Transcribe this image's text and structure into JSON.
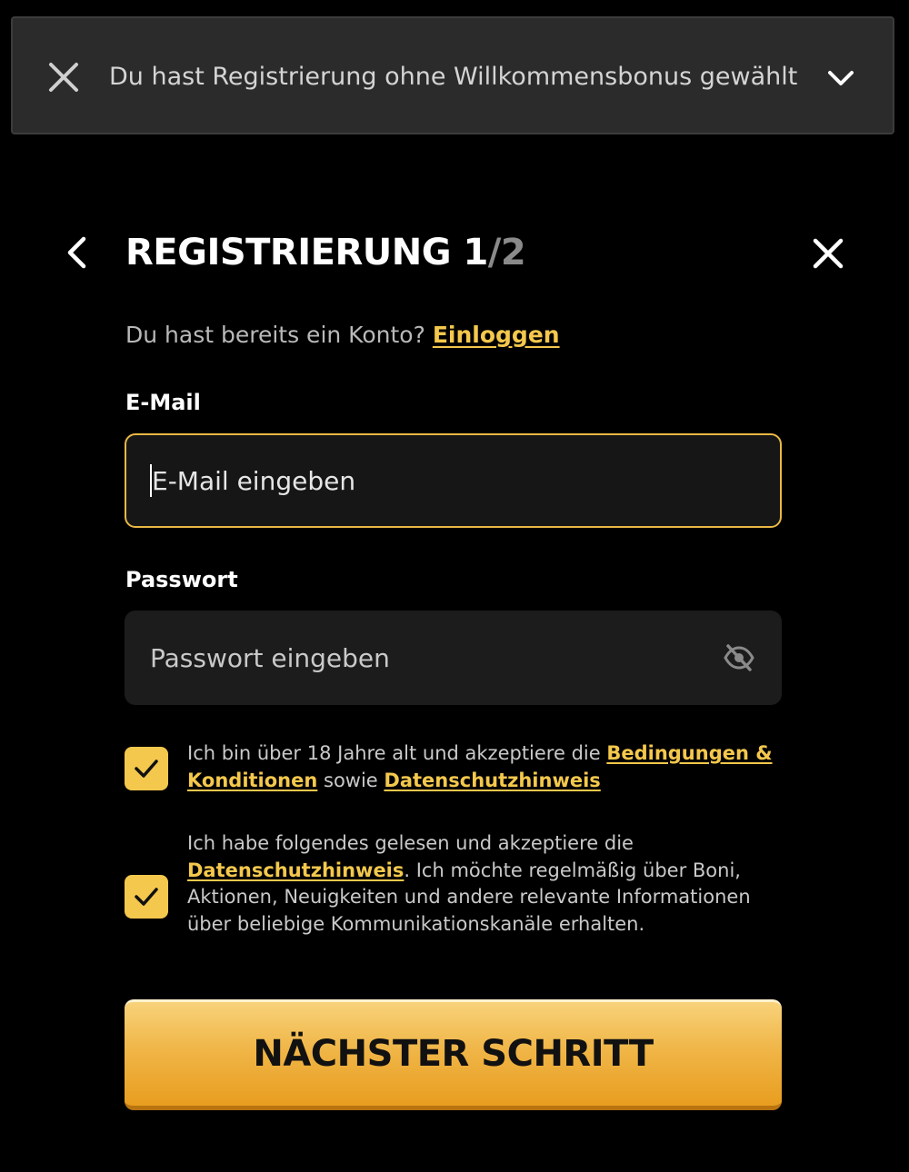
{
  "banner": {
    "text": "Du hast Registrierung ohne Willkommensbonus gewählt",
    "close_icon": "close-icon",
    "expand_icon": "chevron-down-icon"
  },
  "header": {
    "title_main": "REGISTRIERUNG 1",
    "title_total": "/2",
    "back_icon": "chevron-left-icon",
    "close_icon": "close-icon"
  },
  "login": {
    "prompt": "Du hast bereits ein Konto?",
    "link": "Einloggen"
  },
  "email": {
    "label": "E-Mail",
    "placeholder": "E-Mail eingeben",
    "value": ""
  },
  "password": {
    "label": "Passwort",
    "placeholder": "Passwort eingeben",
    "value": "",
    "toggle_icon": "eye-off-icon"
  },
  "consents": [
    {
      "checked": true,
      "text_before": "Ich bin über 18 Jahre alt und akzeptiere die ",
      "link1": "Bedingungen & Konditionen",
      "text_middle": " sowie ",
      "link2": "Datenschutzhinweis"
    },
    {
      "checked": true,
      "text_before": "Ich habe folgendes gelesen und akzeptiere die ",
      "link1": "Datenschutzhinweis",
      "text_after": ". Ich möchte regelmäßig über Boni, Aktionen, Neuigkeiten und andere relevante Informationen über beliebige Kommunikationskanäle erhalten."
    }
  ],
  "submit": {
    "label": "NÄCHSTER SCHRITT"
  },
  "colors": {
    "accent": "#f4c84c",
    "background": "#000000",
    "banner": "#2b2b2b",
    "input": "#1c1c1c"
  }
}
